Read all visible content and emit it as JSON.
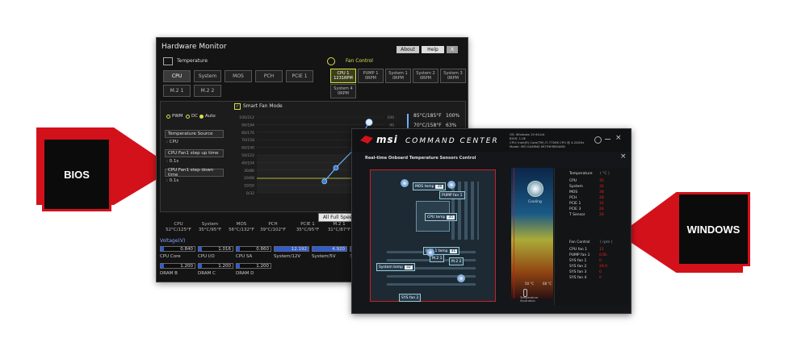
{
  "labels": {
    "bios": "BIOS",
    "windows": "WINDOWS"
  },
  "bios": {
    "window_title": "Hardware Monitor",
    "buttons": {
      "about": "About",
      "help": "Help",
      "close": "X"
    },
    "temperature_header": "Temperature",
    "fan_control_header": "Fan Control",
    "temp_tabs": [
      "CPU",
      "System",
      "MOS",
      "PCH",
      "PCIE 1",
      "M.2 1",
      "M.2 2"
    ],
    "fan_tabs": [
      {
        "name": "CPU 1",
        "value": "1231RPM"
      },
      {
        "name": "PUMP 1",
        "value": "0RPM"
      },
      {
        "name": "System 1",
        "value": "0RPM"
      },
      {
        "name": "System 2",
        "value": "0RPM"
      },
      {
        "name": "System 3",
        "value": "0RPM"
      },
      {
        "name": "System 4",
        "value": "0RPM"
      }
    ],
    "mode": {
      "pwm": "PWM",
      "dc": "DC",
      "auto": "Auto",
      "smart_fan": "Smart Fan Mode"
    },
    "settings": [
      {
        "label": "Temperature Source",
        "value": ": CPU"
      },
      {
        "label": "CPU Fan1 step up time",
        "value": ": 0.1s"
      },
      {
        "label": "CPU Fan1 step down time",
        "value": ": 0.1s"
      }
    ],
    "chart_data": {
      "type": "line",
      "y_left_ticks": [
        "100/212",
        "90/194",
        "80/176",
        "70/158",
        "60/140",
        "50/122",
        "40/104",
        "30/86",
        "20/68",
        "10/50",
        "0/32"
      ],
      "y_right_ticks": [
        "100",
        "90",
        "80",
        "70",
        "60",
        "50",
        "40",
        "30",
        "20",
        "10",
        "0"
      ],
      "points": [
        {
          "x": 0.53,
          "y": 0.15
        },
        {
          "x": 0.62,
          "y": 0.33
        },
        {
          "x": 0.76,
          "y": 0.57
        },
        {
          "x": 0.88,
          "y": 0.93
        }
      ],
      "legend": [
        {
          "temp": "85°C/185°F",
          "pct": "100%"
        },
        {
          "temp": "70°C/158°F",
          "pct": "63%"
        }
      ]
    },
    "all_full_speed": "All Full Speed",
    "sensors": [
      {
        "name": "CPU",
        "value": "52°C/125°F"
      },
      {
        "name": "System",
        "value": "35°C/95°F"
      },
      {
        "name": "MOS",
        "value": "56°C/132°F"
      },
      {
        "name": "PCH",
        "value": "39°C/102°F"
      },
      {
        "name": "PCIE 1",
        "value": "35°C/95°F"
      },
      {
        "name": "M.2 1",
        "value": "31°C/87°F"
      },
      {
        "name": "M.2 2",
        "value": "0\""
      }
    ],
    "voltage_label": "Voltage(V)",
    "voltages_row1": [
      {
        "name": "CPU Core",
        "value": "0.840"
      },
      {
        "name": "CPU I/O",
        "value": "1.016"
      },
      {
        "name": "CPU SA",
        "value": "0.860"
      },
      {
        "name": "System/12V",
        "value": "12.192"
      },
      {
        "name": "System/5V",
        "value": "4.920"
      },
      {
        "name": "3",
        "value": ""
      }
    ],
    "voltages_row2": [
      {
        "name": "DRAM B",
        "value": "1.200"
      },
      {
        "name": "DRAM C",
        "value": "1.200"
      },
      {
        "name": "DRAM D",
        "value": "1.200"
      }
    ]
  },
  "cc": {
    "brand": "msi",
    "product": "COMMAND CENTER",
    "sysinfo": [
      "OS: Windows 10 64-bit",
      "BIOS: 1.0E",
      "CPU: Intel(R) Core(TM) i7-7700K CPU @ 4.20GHz",
      "Model: MSI GAMING MOTHERBOARD"
    ],
    "subtitle": "Real-time Onboard Temperature Sensors Control",
    "board_tags": [
      {
        "label": "MOS temp",
        "value": "38"
      },
      {
        "label": "PUMP fan 1",
        "value": ""
      },
      {
        "label": "CPU temp",
        "value": "35"
      },
      {
        "label": "PCIE 1 temp",
        "value": "31"
      },
      {
        "label": "M.2 1",
        "value": ""
      },
      {
        "label": "M.2 2",
        "value": ""
      },
      {
        "label": "System temp",
        "value": "32"
      },
      {
        "label": "SYS fan 2",
        "value": ""
      }
    ],
    "cooling": "Cooling",
    "axis_low": "50 °C",
    "axis_high": "68 °C",
    "temp_illustration": "Temperature Illustration",
    "temperature_header": "Temperature",
    "temperature_unit": "( °C )",
    "temperature_rows": [
      {
        "name": "CPU",
        "value": "35"
      },
      {
        "name": "System",
        "value": "32"
      },
      {
        "name": "MOS",
        "value": "38"
      },
      {
        "name": "PCH",
        "value": "28"
      },
      {
        "name": "PCIE 1",
        "value": "31"
      },
      {
        "name": "PCIE 3",
        "value": "26"
      },
      {
        "name": "T Sensor",
        "value": "26"
      }
    ],
    "fan_header": "Fan Control",
    "fan_unit": "( rpm )",
    "fan_rows": [
      {
        "name": "CPU fan 1",
        "value": "12"
      },
      {
        "name": "PUMP fan 1",
        "value": "0.0k"
      },
      {
        "name": "SYS fan 1",
        "value": "0"
      },
      {
        "name": "SYS fan 2",
        "value": "29.0"
      },
      {
        "name": "SYS fan 3",
        "value": "0"
      },
      {
        "name": "SYS fan 4",
        "value": "0"
      }
    ]
  },
  "colors": {
    "accent_red": "#d3111b",
    "bios_accent": "#d8e04a",
    "voltage_blue": "#2e5bd8"
  }
}
